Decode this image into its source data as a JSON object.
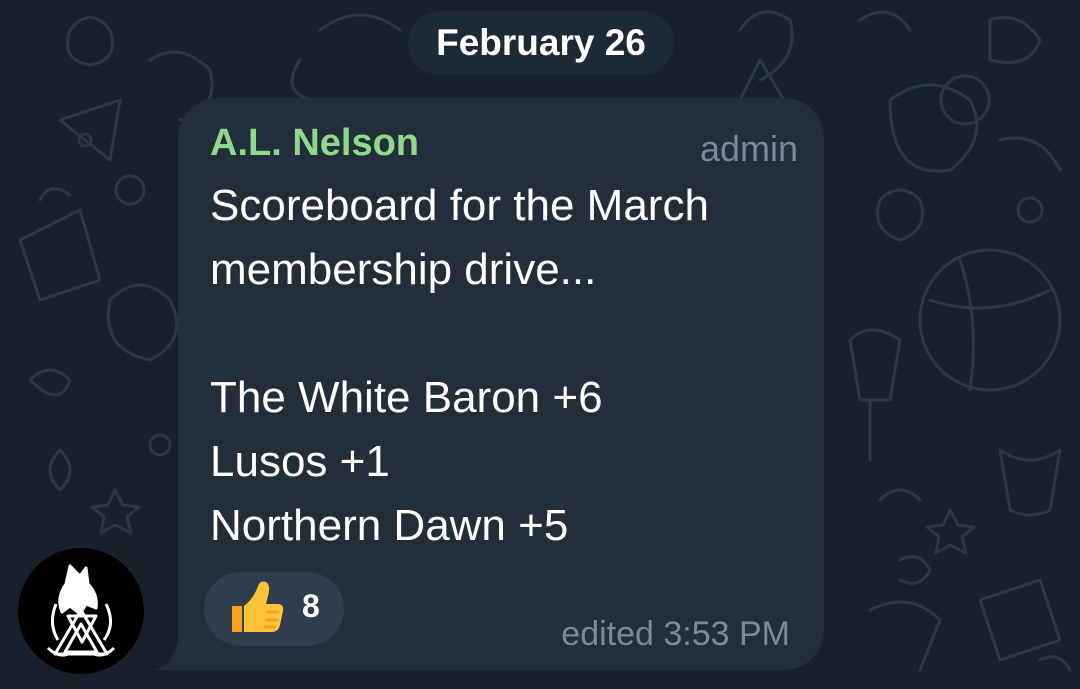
{
  "chat": {
    "date_separator": "February 26"
  },
  "message": {
    "sender": "A.L. Nelson",
    "role": "admin",
    "lines": [
      "Scoreboard for the March",
      "membership drive...",
      "",
      "The White Baron +6",
      "Lusos +1",
      "Northern Dawn +5"
    ],
    "reaction": {
      "icon": "thumbs-up-icon",
      "count": "8"
    },
    "status": "edited 3:53 PM"
  },
  "colors": {
    "background": "#17212b",
    "bubble": "#222e3a",
    "sender_name": "#8fd98b",
    "meta_text": "#7b8a99"
  }
}
